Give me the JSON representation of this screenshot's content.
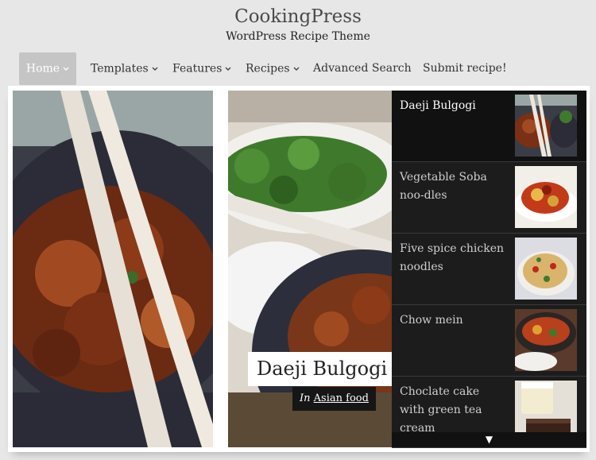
{
  "site": {
    "title": "CookingPress",
    "tagline": "WordPress Recipe Theme"
  },
  "nav": {
    "items": [
      {
        "label": "Home",
        "has_dropdown": true,
        "active": true
      },
      {
        "label": "Templates",
        "has_dropdown": true
      },
      {
        "label": "Features",
        "has_dropdown": true
      },
      {
        "label": "Recipes",
        "has_dropdown": true
      },
      {
        "label": "Advanced Search",
        "has_dropdown": false
      },
      {
        "label": "Submit recipe!",
        "has_dropdown": false
      }
    ]
  },
  "featured": {
    "title": "Daeji Bulgogi",
    "category_prefix": "In",
    "category": "Asian food"
  },
  "slider_list": {
    "items": [
      {
        "label": "Daeji Bulgogi",
        "current": true
      },
      {
        "label": "Vegetable Soba noo-dles"
      },
      {
        "label": "Five spice chicken noodles"
      },
      {
        "label": "Chow mein"
      },
      {
        "label": "Choclate cake with green tea cream"
      }
    ],
    "scroll_glyph": "▼"
  },
  "colors": {
    "page_bg": "#e7e7e7",
    "nav_active_bg": "#c5c5c5",
    "slider_list_bg": "#1c1c1c"
  }
}
